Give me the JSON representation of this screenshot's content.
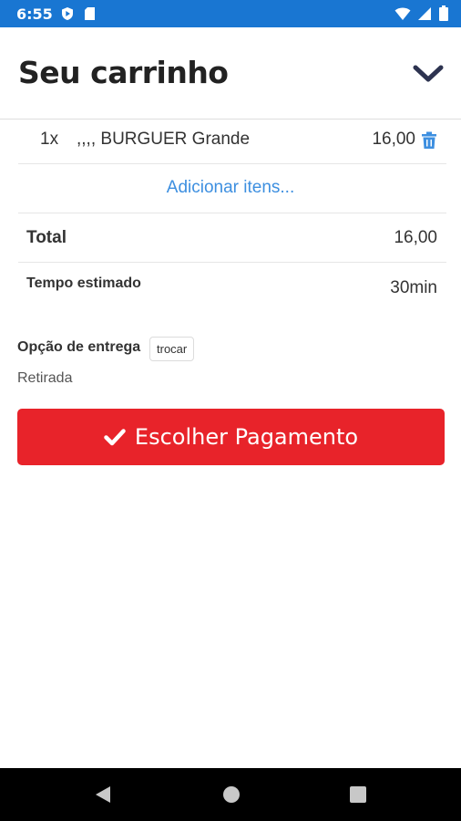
{
  "status_bar": {
    "time": "6:55",
    "icons": [
      "play-protect-icon",
      "sd-card-icon",
      "wifi-icon",
      "signal-icon",
      "battery-icon"
    ],
    "color": "#1976d2"
  },
  "header": {
    "title": "Seu carrinho",
    "collapse_icon": "chevron-down-icon"
  },
  "cart": {
    "items": [
      {
        "qty": "1x",
        "name": ",,,, BURGUER Grande",
        "price": "16,00",
        "delete_icon": "trash-icon"
      }
    ],
    "add_items_label": "Adicionar itens..."
  },
  "summary": {
    "total_label": "Total",
    "total_value": "16,00",
    "time_label": "Tempo estimado",
    "time_value": "30min"
  },
  "delivery": {
    "label": "Opção de entrega",
    "change_button": "trocar",
    "value": "Retirada"
  },
  "payment_button": {
    "label": "Escolher Pagamento",
    "icon": "check-icon",
    "color": "#e8232a"
  },
  "nav_bar": {
    "buttons": [
      "back-icon",
      "home-icon",
      "recents-icon"
    ]
  },
  "accent_color": "#3d8fe0"
}
